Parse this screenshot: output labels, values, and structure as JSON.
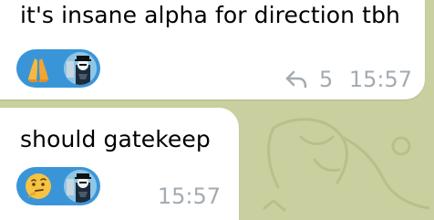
{
  "messages": [
    {
      "text": "it's insane alpha for direction tbh",
      "reactions": [
        {
          "emoji": "praying-hands",
          "icon": "praying-hands-icon"
        },
        {
          "avatar": "reactor-avatar"
        }
      ],
      "replies": "5",
      "time": "15:57"
    },
    {
      "text": "should gatekeep",
      "reactions": [
        {
          "emoji": "thinking-face",
          "icon": "thinking-face-icon"
        },
        {
          "avatar": "reactor-avatar"
        }
      ],
      "time": "15:57"
    }
  ],
  "colors": {
    "background": "#c9cf9e",
    "bubble": "#ffffff",
    "reaction_pill": "#3a95d8",
    "meta_text": "#a3abb2"
  }
}
